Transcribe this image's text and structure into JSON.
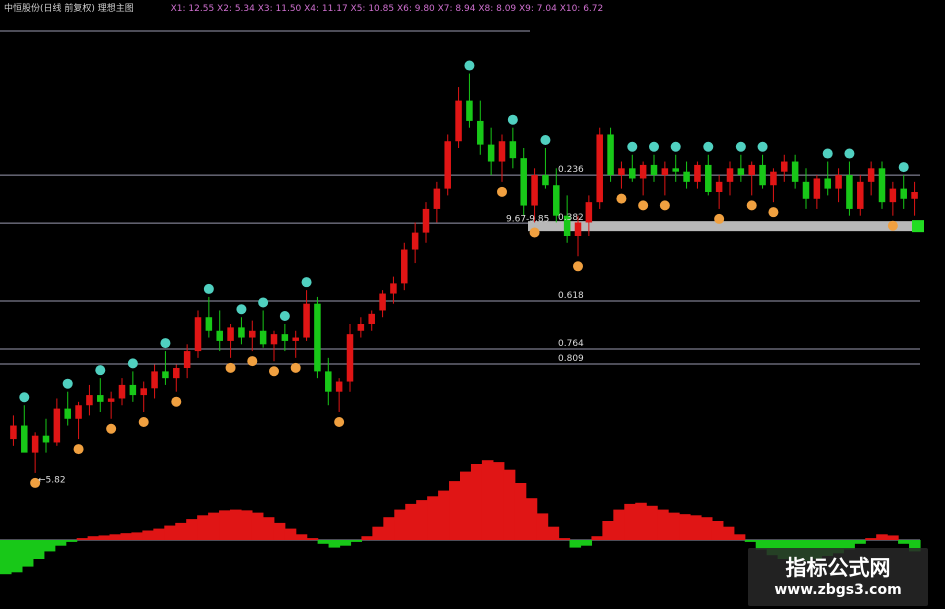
{
  "header": {
    "name": "中恒股份(日线 前复权) 理想主图",
    "x_levels": "X1: 12.55 X2: 5.34 X3: 11.50 X4: 11.17 X5: 10.85 X6: 9.80 X7: 8.94 X8: 8.09 X9: 7.04 X10: 6.72"
  },
  "chart_data": {
    "type": "candlestick",
    "fib_levels": [
      {
        "label": "0.236",
        "value": 10.3
      },
      {
        "label": "0.382",
        "value": 9.59
      },
      {
        "label": "0.618",
        "value": 8.44
      },
      {
        "label": "0.764",
        "value": 7.73
      },
      {
        "label": "0.809",
        "value": 7.51
      }
    ],
    "annotations": [
      {
        "text": "←5.82",
        "value": 5.82
      },
      {
        "text": "9.67-9.85",
        "value": 9.67
      }
    ],
    "colors": {
      "up": "#e01515",
      "down": "#18c818",
      "level_line": "#9a9ab0",
      "band": "#b8b8b8",
      "marker_up": "#f0a040",
      "marker_down": "#50d0c0"
    },
    "candles": [
      [
        6.4,
        6.75,
        6.3,
        6.6
      ],
      [
        6.6,
        6.9,
        6.4,
        6.2
      ],
      [
        6.2,
        6.5,
        5.9,
        6.45
      ],
      [
        6.45,
        6.7,
        6.2,
        6.35
      ],
      [
        6.35,
        7.0,
        6.3,
        6.85
      ],
      [
        6.85,
        7.1,
        6.6,
        6.7
      ],
      [
        6.7,
        6.95,
        6.4,
        6.9
      ],
      [
        6.9,
        7.2,
        6.75,
        7.05
      ],
      [
        7.05,
        7.3,
        6.8,
        6.95
      ],
      [
        6.95,
        7.1,
        6.7,
        7.0
      ],
      [
        7.0,
        7.3,
        6.9,
        7.2
      ],
      [
        7.2,
        7.4,
        6.95,
        7.05
      ],
      [
        7.05,
        7.25,
        6.8,
        7.15
      ],
      [
        7.15,
        7.5,
        7.0,
        7.4
      ],
      [
        7.4,
        7.7,
        7.2,
        7.3
      ],
      [
        7.3,
        7.5,
        7.1,
        7.45
      ],
      [
        7.45,
        7.8,
        7.3,
        7.7
      ],
      [
        7.7,
        8.3,
        7.6,
        8.2
      ],
      [
        8.2,
        8.5,
        7.9,
        8.0
      ],
      [
        8.0,
        8.3,
        7.7,
        7.85
      ],
      [
        7.85,
        8.1,
        7.6,
        8.05
      ],
      [
        8.05,
        8.2,
        7.8,
        7.9
      ],
      [
        7.9,
        8.15,
        7.7,
        8.0
      ],
      [
        8.0,
        8.3,
        7.75,
        7.8
      ],
      [
        7.8,
        8.0,
        7.55,
        7.95
      ],
      [
        7.95,
        8.1,
        7.7,
        7.85
      ],
      [
        7.85,
        8.0,
        7.6,
        7.9
      ],
      [
        7.9,
        8.6,
        7.85,
        8.4
      ],
      [
        8.4,
        8.5,
        7.3,
        7.4
      ],
      [
        7.4,
        7.6,
        6.9,
        7.1
      ],
      [
        7.1,
        7.3,
        6.8,
        7.25
      ],
      [
        7.25,
        8.1,
        7.1,
        7.95
      ],
      [
        8.0,
        8.2,
        7.9,
        8.1
      ],
      [
        8.1,
        8.3,
        8.0,
        8.25
      ],
      [
        8.3,
        8.6,
        8.2,
        8.55
      ],
      [
        8.55,
        8.8,
        8.4,
        8.7
      ],
      [
        8.7,
        9.3,
        8.6,
        9.2
      ],
      [
        9.2,
        9.6,
        9.0,
        9.45
      ],
      [
        9.45,
        9.9,
        9.3,
        9.8
      ],
      [
        9.8,
        10.2,
        9.6,
        10.1
      ],
      [
        10.1,
        10.9,
        10.0,
        10.8
      ],
      [
        10.8,
        11.6,
        10.7,
        11.4
      ],
      [
        11.4,
        11.8,
        11.0,
        11.1
      ],
      [
        11.1,
        11.4,
        10.6,
        10.75
      ],
      [
        10.75,
        11.0,
        10.3,
        10.5
      ],
      [
        10.5,
        10.9,
        10.2,
        10.8
      ],
      [
        10.8,
        11.0,
        10.4,
        10.55
      ],
      [
        10.55,
        10.7,
        9.7,
        9.85
      ],
      [
        9.85,
        10.4,
        9.6,
        10.3
      ],
      [
        10.3,
        10.7,
        10.1,
        10.15
      ],
      [
        10.15,
        10.4,
        9.6,
        9.7
      ],
      [
        9.7,
        10.0,
        9.3,
        9.4
      ],
      [
        9.4,
        9.7,
        9.1,
        9.6
      ],
      [
        9.6,
        10.0,
        9.4,
        9.9
      ],
      [
        9.9,
        11.0,
        9.8,
        10.9
      ],
      [
        10.9,
        11.0,
        10.2,
        10.3
      ],
      [
        10.3,
        10.5,
        10.1,
        10.4
      ],
      [
        10.4,
        10.6,
        10.2,
        10.25
      ],
      [
        10.25,
        10.5,
        10.0,
        10.45
      ],
      [
        10.45,
        10.6,
        10.2,
        10.3
      ],
      [
        10.3,
        10.5,
        10.0,
        10.4
      ],
      [
        10.4,
        10.6,
        10.2,
        10.35
      ],
      [
        10.35,
        10.5,
        10.1,
        10.2
      ],
      [
        10.2,
        10.5,
        10.1,
        10.45
      ],
      [
        10.45,
        10.6,
        10.0,
        10.05
      ],
      [
        10.05,
        10.3,
        9.8,
        10.2
      ],
      [
        10.2,
        10.5,
        10.0,
        10.4
      ],
      [
        10.4,
        10.6,
        10.2,
        10.3
      ],
      [
        10.3,
        10.5,
        10.0,
        10.45
      ],
      [
        10.45,
        10.6,
        10.1,
        10.15
      ],
      [
        10.15,
        10.4,
        9.9,
        10.35
      ],
      [
        10.35,
        10.6,
        10.2,
        10.5
      ],
      [
        10.5,
        10.6,
        10.1,
        10.2
      ],
      [
        10.2,
        10.4,
        9.8,
        9.95
      ],
      [
        9.95,
        10.3,
        9.8,
        10.25
      ],
      [
        10.25,
        10.5,
        10.0,
        10.1
      ],
      [
        10.1,
        10.4,
        9.9,
        10.3
      ],
      [
        10.3,
        10.5,
        9.7,
        9.8
      ],
      [
        9.8,
        10.3,
        9.7,
        10.2
      ],
      [
        10.2,
        10.5,
        10.0,
        10.4
      ],
      [
        10.4,
        10.5,
        9.8,
        9.9
      ],
      [
        9.9,
        10.2,
        9.7,
        10.1
      ],
      [
        10.1,
        10.3,
        9.8,
        9.95
      ],
      [
        9.95,
        10.2,
        9.7,
        10.05
      ]
    ],
    "oscillator": [
      -0.9,
      -0.85,
      -0.7,
      -0.5,
      -0.3,
      -0.15,
      -0.05,
      0.05,
      0.1,
      0.12,
      0.15,
      0.18,
      0.2,
      0.25,
      0.3,
      0.38,
      0.45,
      0.55,
      0.65,
      0.72,
      0.78,
      0.8,
      0.78,
      0.72,
      0.6,
      0.45,
      0.3,
      0.15,
      0.05,
      -0.1,
      -0.2,
      -0.15,
      -0.05,
      0.1,
      0.35,
      0.6,
      0.8,
      0.95,
      1.05,
      1.15,
      1.3,
      1.55,
      1.8,
      2.0,
      2.1,
      2.05,
      1.85,
      1.5,
      1.1,
      0.7,
      0.35,
      0.05,
      -0.2,
      -0.15,
      0.1,
      0.5,
      0.8,
      0.95,
      0.98,
      0.9,
      0.8,
      0.72,
      0.68,
      0.65,
      0.6,
      0.5,
      0.35,
      0.15,
      -0.05,
      -0.25,
      -0.4,
      -0.5,
      -0.55,
      -0.55,
      -0.5,
      -0.42,
      -0.35,
      -0.25,
      -0.1,
      0.05,
      0.15,
      0.12,
      -0.1,
      -0.3
    ]
  },
  "watermark": {
    "title": "指标公式网",
    "url": "www.zbgs3.com"
  }
}
